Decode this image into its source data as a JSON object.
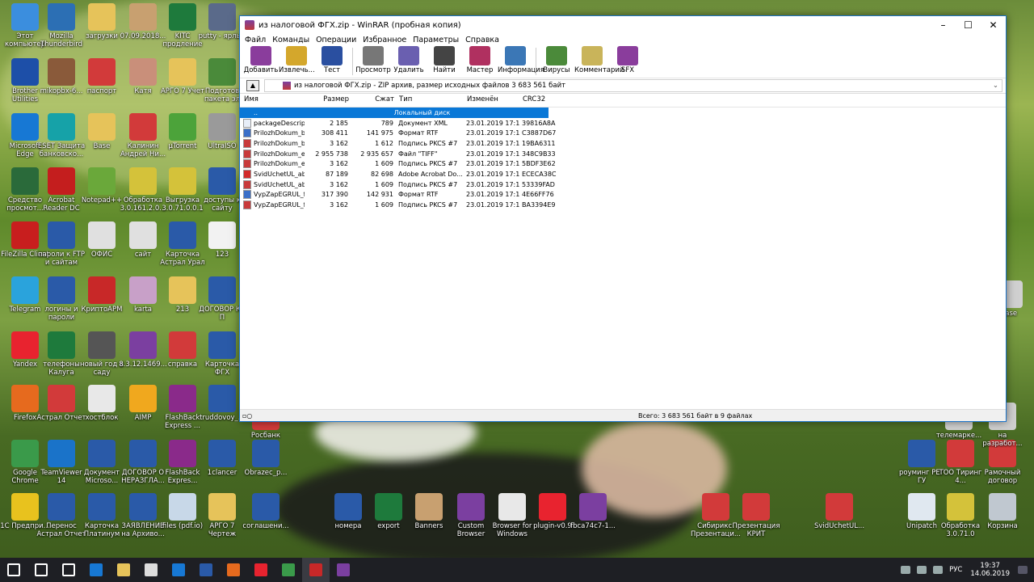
{
  "window": {
    "title": "из налоговой ФГХ.zip - WinRAR (пробная копия)",
    "menu": [
      "Файл",
      "Команды",
      "Операции",
      "Избранное",
      "Параметры",
      "Справка"
    ],
    "toolbar": [
      {
        "label": "Добавить",
        "icon": "books-add-icon",
        "color": "#8a3d9c"
      },
      {
        "label": "Извлечь...",
        "icon": "folder-extract-icon",
        "color": "#d4a72c"
      },
      {
        "label": "Тест",
        "icon": "book-test-icon",
        "color": "#2a4fa0"
      },
      {
        "label": "Просмотр",
        "icon": "glasses-view-icon",
        "color": "#777777"
      },
      {
        "label": "Удалить",
        "icon": "trash-delete-icon",
        "color": "#6a5fb0"
      },
      {
        "label": "Найти",
        "icon": "binoculars-find-icon",
        "color": "#444444"
      },
      {
        "label": "Мастер",
        "icon": "wizard-icon",
        "color": "#b03060"
      },
      {
        "label": "Информация",
        "icon": "info-icon",
        "color": "#3b77b6"
      },
      {
        "label": "Вирусы",
        "icon": "virus-scan-icon",
        "color": "#4b8a3a"
      },
      {
        "label": "Комментарий",
        "icon": "comment-icon",
        "color": "#c9b45a"
      },
      {
        "label": "SFX",
        "icon": "sfx-icon",
        "color": "#8a3d9c"
      }
    ],
    "path": "из налоговой ФГХ.zip - ZIP архив, размер исходных файлов 3 683 561 байт",
    "columns": [
      "Имя",
      "Размер",
      "Сжат",
      "Тип",
      "Изменён",
      "CRC32"
    ],
    "rows": [
      {
        "name": "..",
        "size": "",
        "packed": "",
        "type": "Локальный диск",
        "modified": "",
        "crc": "",
        "icon": "folder-up-icon",
        "selected": true
      },
      {
        "name": "packageDescript...",
        "size": "2 185",
        "packed": "789",
        "type": "Документ XML",
        "modified": "23.01.2019 17:11",
        "crc": "39816A8A",
        "icon": "xml-file-icon"
      },
      {
        "name": "PrilozhDokum_b...",
        "size": "308 411",
        "packed": "141 975",
        "type": "Формат RTF",
        "modified": "23.01.2019 17:11",
        "crc": "C3887D67",
        "icon": "rtf-file-icon"
      },
      {
        "name": "PrilozhDokum_b...",
        "size": "3 162",
        "packed": "1 612",
        "type": "Подпись PKCS #7",
        "modified": "23.01.2019 17:11",
        "crc": "19BA6311",
        "icon": "signature-file-icon"
      },
      {
        "name": "PrilozhDokum_e...",
        "size": "2 955 738",
        "packed": "2 935 657",
        "type": "Файл \"TIFF\"",
        "modified": "23.01.2019 17:11",
        "crc": "348C9B33",
        "icon": "tiff-file-icon"
      },
      {
        "name": "PrilozhDokum_e...",
        "size": "3 162",
        "packed": "1 609",
        "type": "Подпись PKCS #7",
        "modified": "23.01.2019 17:11",
        "crc": "5BDF3E62",
        "icon": "signature-file-icon"
      },
      {
        "name": "SvidUchetUL_ab...",
        "size": "87 189",
        "packed": "82 698",
        "type": "Adobe Acrobat Do...",
        "modified": "23.01.2019 17:11",
        "crc": "ECECA38C",
        "icon": "pdf-file-icon"
      },
      {
        "name": "SvidUchetUL_ab...",
        "size": "3 162",
        "packed": "1 609",
        "type": "Подпись PKCS #7",
        "modified": "23.01.2019 17:11",
        "crc": "53339FAD",
        "icon": "signature-file-icon"
      },
      {
        "name": "VypZapEGRUL_f...",
        "size": "317 390",
        "packed": "142 931",
        "type": "Формат RTF",
        "modified": "23.01.2019 17:11",
        "crc": "4E66FF76",
        "icon": "rtf-file-icon"
      },
      {
        "name": "VypZapEGRUL_f...",
        "size": "3 162",
        "packed": "1 609",
        "type": "Подпись PKCS #7",
        "modified": "23.01.2019 17:11",
        "crc": "BA3394E9",
        "icon": "signature-file-icon"
      }
    ],
    "status": "Всего: 3 683 561 байт в 9 файлах"
  },
  "desktop": {
    "icons": [
      {
        "label": "Этот компьютер",
        "icon": "computer-icon",
        "color": "#3b8ede"
      },
      {
        "label": "Mozilla Thunderbird",
        "icon": "thunderbird-icon",
        "color": "#2c6fb4"
      },
      {
        "label": "загрузки",
        "icon": "folder-icon",
        "color": "#e6c35a"
      },
      {
        "label": "07.09.2018...",
        "icon": "archive-icon",
        "color": "#c8a070"
      },
      {
        "label": "KITC продление",
        "icon": "excel-icon",
        "color": "#1e7a3c"
      },
      {
        "label": "putty - ярлык",
        "icon": "putty-icon",
        "color": "#5a6a8a"
      },
      {
        "label": "Brother Utilities",
        "icon": "brother-icon",
        "color": "#1d4fa8"
      },
      {
        "label": "mikopbx-6...",
        "icon": "disc-icon",
        "color": "#8a5a3a"
      },
      {
        "label": "паспорт",
        "icon": "pdf-icon",
        "color": "#d23a3a"
      },
      {
        "label": "Катя",
        "icon": "photo-icon",
        "color": "#c98f7a"
      },
      {
        "label": "АРГО 7 Учет",
        "icon": "folder-icon",
        "color": "#e6c35a"
      },
      {
        "label": "Подготов пакета эл",
        "icon": "app-icon",
        "color": "#4a8a3a"
      },
      {
        "label": "Microsoft Edge",
        "icon": "edge-icon",
        "color": "#1778d4"
      },
      {
        "label": "ESET Защита банковско...",
        "icon": "eset-icon",
        "color": "#16a2a8"
      },
      {
        "label": "Base",
        "icon": "folder-icon",
        "color": "#e6c35a"
      },
      {
        "label": "Калинин Андрей Ни...",
        "icon": "pdf-icon",
        "color": "#d23a3a"
      },
      {
        "label": "µTorrent",
        "icon": "utorrent-icon",
        "color": "#4ca33a"
      },
      {
        "label": "UltraISO",
        "icon": "disc-icon",
        "color": "#9a9a9a"
      },
      {
        "label": "Средство просмот...",
        "icon": "viewer-icon",
        "color": "#2a6a3a"
      },
      {
        "label": "Acrobat Reader DC",
        "icon": "acrobat-icon",
        "color": "#c41e1e"
      },
      {
        "label": "Notepad++",
        "icon": "notepad-icon",
        "color": "#6aa83a"
      },
      {
        "label": "Обработка 3.0.161.2.0...",
        "icon": "cd-icon",
        "color": "#d4c23a"
      },
      {
        "label": "Выгрузка 3.0.71.0.0.1",
        "icon": "cd-icon",
        "color": "#d4c23a"
      },
      {
        "label": "доступы к сайту",
        "icon": "word-icon",
        "color": "#2a5aa8"
      },
      {
        "label": "FileZilla Client",
        "icon": "filezilla-icon",
        "color": "#c81e1e"
      },
      {
        "label": "пароли к FTP и сайтам",
        "icon": "word-icon",
        "color": "#2a5aa8"
      },
      {
        "label": "ОФИС",
        "icon": "zip-icon",
        "color": "#e0e0e0"
      },
      {
        "label": "сайт",
        "icon": "file-icon",
        "color": "#e0e0e0"
      },
      {
        "label": "Карточка Астрал Урал",
        "icon": "word-icon",
        "color": "#2a5aa8"
      },
      {
        "label": "123",
        "icon": "file-icon",
        "color": "#f2f2f2"
      },
      {
        "label": "Telegram",
        "icon": "telegram-icon",
        "color": "#2aa3dc"
      },
      {
        "label": "логины и пароли",
        "icon": "word-icon",
        "color": "#2a5aa8"
      },
      {
        "label": "КриптоАРМ",
        "icon": "cryptoarm-icon",
        "color": "#c82828"
      },
      {
        "label": "karta",
        "icon": "image-icon",
        "color": "#c8a0c8"
      },
      {
        "label": "213",
        "icon": "folder-icon",
        "color": "#e6c35a"
      },
      {
        "label": "ДОГОВОР КА П",
        "icon": "word-icon",
        "color": "#2a5aa8"
      },
      {
        "label": "Yandex",
        "icon": "yandex-icon",
        "color": "#e8232f"
      },
      {
        "label": "телефоны Калуга",
        "icon": "excel-icon",
        "color": "#1e7a3c"
      },
      {
        "label": "новый год в саду",
        "icon": "video-icon",
        "color": "#555555"
      },
      {
        "label": "8.3.12.1469...",
        "icon": "winrar-icon",
        "color": "#7b3fa0"
      },
      {
        "label": "справка",
        "icon": "pdf-icon",
        "color": "#d23a3a"
      },
      {
        "label": "Карточка ФГХ",
        "icon": "word-icon",
        "color": "#2a5aa8"
      },
      {
        "label": "Firefox",
        "icon": "firefox-icon",
        "color": "#e66a1e"
      },
      {
        "label": "Астрал Отчет",
        "icon": "astral-icon",
        "color": "#d23a3a"
      },
      {
        "label": "хостблок",
        "icon": "file-icon",
        "color": "#e8e8e8"
      },
      {
        "label": "AIMP",
        "icon": "aimp-icon",
        "color": "#f0a81e"
      },
      {
        "label": "FlashBack Express ...",
        "icon": "flashback-icon",
        "color": "#8a2a8a"
      },
      {
        "label": "truddovoy_...",
        "icon": "word-icon",
        "color": "#2a5aa8"
      },
      {
        "label": "Google Chrome",
        "icon": "chrome-icon",
        "color": "#3a9a4a"
      },
      {
        "label": "TeamViewer 14",
        "icon": "teamviewer-icon",
        "color": "#1a73c9"
      },
      {
        "label": "Документ Microso...",
        "icon": "word-icon",
        "color": "#2a5aa8"
      },
      {
        "label": "ДОГОВОР О НЕРАЗГЛА...",
        "icon": "word-icon",
        "color": "#2a5aa8"
      },
      {
        "label": "FlashBack Expres...",
        "icon": "flashback-icon",
        "color": "#8a2a8a"
      },
      {
        "label": "1clancer",
        "icon": "word-icon",
        "color": "#2a5aa8"
      },
      {
        "label": "1С Предпри...",
        "icon": "1c-icon",
        "color": "#e8c21e"
      },
      {
        "label": "Перенос Астрал Отчет",
        "icon": "word-icon",
        "color": "#2a5aa8"
      },
      {
        "label": "Карточка Платинум",
        "icon": "word-icon",
        "color": "#2a5aa8"
      },
      {
        "label": "ЗАЯВЛЕНИЕ на Архиво...",
        "icon": "word-icon",
        "color": "#2a5aa8"
      },
      {
        "label": "files (pdf.io)",
        "icon": "zip-icon",
        "color": "#c8d8e8"
      },
      {
        "label": "АРГО 7 Чертеж",
        "icon": "argo-icon",
        "color": "#e6c35a"
      },
      {
        "label": "Росбанк",
        "icon": "bank-icon",
        "color": "#d23a3a"
      },
      {
        "label": "Obrazec_p...",
        "icon": "word-icon",
        "color": "#2a5aa8"
      },
      {
        "label": "соглашени...",
        "icon": "word-icon",
        "color": "#2a5aa8"
      },
      {
        "label": "номера",
        "icon": "word-icon",
        "color": "#2a5aa8"
      },
      {
        "label": "export",
        "icon": "excel-icon",
        "color": "#1e7a3c"
      },
      {
        "label": "Banners",
        "icon": "archive-icon",
        "color": "#c8a070"
      },
      {
        "label": "Custom Browser",
        "icon": "winrar-icon",
        "color": "#7b3fa0"
      },
      {
        "label": "Browser for Windows",
        "icon": "browser-icon",
        "color": "#e8e8e8"
      },
      {
        "label": "plugin-v0.9",
        "icon": "yandex-icon",
        "color": "#e8232f"
      },
      {
        "label": "fbca74c7-1...",
        "icon": "winrar-icon",
        "color": "#7b3fa0"
      },
      {
        "label": "Сибирикс. Презентаци...",
        "icon": "pdf-icon",
        "color": "#d23a3a"
      },
      {
        "label": "Презентация КРИТ",
        "icon": "pdf-icon",
        "color": "#d23a3a"
      },
      {
        "label": "SvidUchetUL...",
        "icon": "pdf-icon",
        "color": "#d23a3a"
      },
      {
        "label": "роуминг РЕГ ГУ",
        "icon": "word-icon",
        "color": "#2a5aa8"
      },
      {
        "label": "ТОО Тиринг 4...",
        "icon": "pdf-icon",
        "color": "#d23a3a"
      },
      {
        "label": "Рамочный договор",
        "icon": "pdf-icon",
        "color": "#d23a3a"
      },
      {
        "label": "Unipatch",
        "icon": "file-icon",
        "color": "#e0e8f0"
      },
      {
        "label": "Обработка 3.0.71.0",
        "icon": "cd-icon",
        "color": "#d4c23a"
      },
      {
        "label": "Корзина",
        "icon": "recycle-bin-icon",
        "color": "#c0c8d0"
      },
      {
        "label": "телемарке...",
        "icon": "file-icon",
        "color": "#d0d0d0"
      },
      {
        "label": "на разработ...",
        "icon": "file-icon",
        "color": "#d0d0d0"
      },
      {
        "label": "base",
        "icon": "file-icon",
        "color": "#d0d0d0"
      }
    ]
  },
  "taskbar": {
    "items": [
      {
        "icon": "windows-start-icon",
        "color": "#ffffff"
      },
      {
        "icon": "search-icon",
        "color": "#ffffff"
      },
      {
        "icon": "task-view-icon",
        "color": "#ffffff"
      },
      {
        "icon": "edge-icon",
        "color": "#1778d4"
      },
      {
        "icon": "file-explorer-icon",
        "color": "#e6c35a"
      },
      {
        "icon": "store-icon",
        "color": "#dddddd"
      },
      {
        "icon": "mail-icon",
        "color": "#1778d4"
      },
      {
        "icon": "word-icon",
        "color": "#2a5aa8"
      },
      {
        "icon": "firefox-icon",
        "color": "#e66a1e"
      },
      {
        "icon": "yandex-icon",
        "color": "#e8232f"
      },
      {
        "icon": "chrome-icon",
        "color": "#3a9a4a"
      },
      {
        "icon": "cryptoarm-icon",
        "color": "#c82828"
      },
      {
        "icon": "winrar-icon",
        "color": "#7b3fa0"
      }
    ],
    "language": "РУС",
    "time": "19:37",
    "date": "14.06.2019"
  }
}
